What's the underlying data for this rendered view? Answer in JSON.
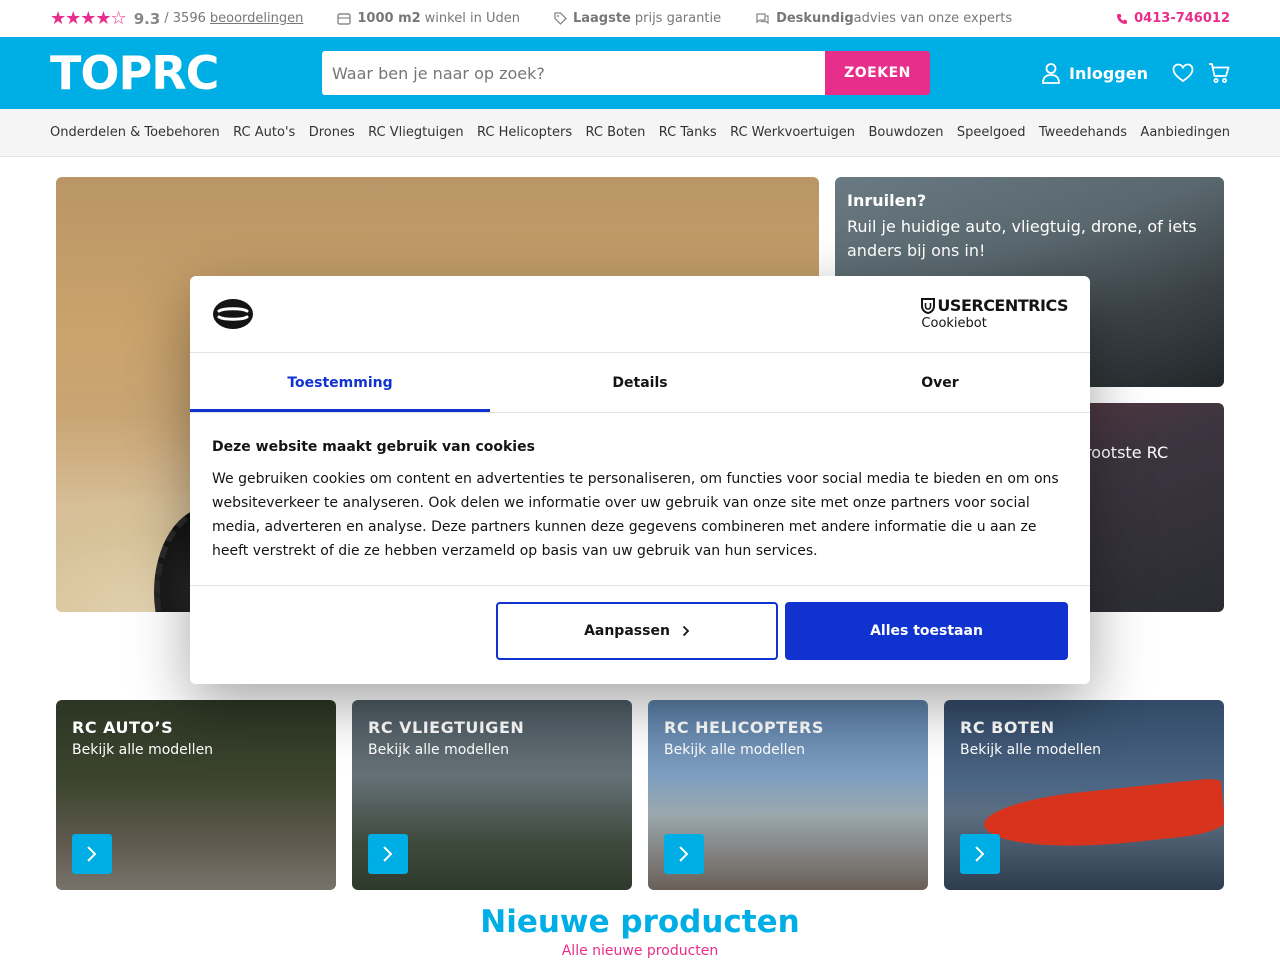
{
  "topbar": {
    "stars": "★★★★☆",
    "score": "9.3",
    "reviews_sep": "/ 3596",
    "reviews_link": "beoordelingen",
    "usp1_bold": "1000 m2",
    "usp1_text": "winkel in Uden",
    "usp2_bold": "Laagste",
    "usp2_text": "prijs garantie",
    "usp3_bold": "Deskundig",
    "usp3_text": "advies van onze experts",
    "phone": "0413-746012"
  },
  "header": {
    "logo": "TOPRC",
    "search_placeholder": "Waar ben je naar op zoek?",
    "search_button": "ZOEKEN",
    "login": "Inloggen"
  },
  "nav": {
    "items": [
      "Onderdelen & Toebehoren",
      "RC Auto's",
      "Drones",
      "RC Vliegtuigen",
      "RC Helicopters",
      "RC Boten",
      "RC Tanks",
      "RC Werkvoertuigen",
      "Bouwdozen",
      "Speelgoed",
      "Tweedehands",
      "Aanbiedingen"
    ]
  },
  "hero": {
    "trade_title": "Inruilen?",
    "trade_desc": "Ruil je huidige auto, vliegtuig, drone, of iets anders bij ons in!",
    "store_desc_partial": "rootste RC"
  },
  "categories": [
    {
      "name": "RC AUTO’S",
      "sub": "Bekijk alle modellen"
    },
    {
      "name": "RC VLIEGTUIGEN",
      "sub": "Bekijk alle modellen"
    },
    {
      "name": "RC HELICOPTERS",
      "sub": "Bekijk alle modellen"
    },
    {
      "name": "RC BOTEN",
      "sub": "Bekijk alle modellen"
    }
  ],
  "new_products": {
    "title": "Nieuwe producten",
    "link": "Alle nieuwe producten"
  },
  "cookie": {
    "brand_top": "USERCENTRICS",
    "brand_bottom": "Cookiebot",
    "tabs": [
      "Toestemming",
      "Details",
      "Over"
    ],
    "heading": "Deze website maakt gebruik van cookies",
    "text": "We gebruiken cookies om content en advertenties te personaliseren, om functies voor social media te bieden en om ons websiteverkeer te analyseren. Ook delen we informatie over uw gebruik van onze site met onze partners voor social media, adverteren en analyse. Deze partners kunnen deze gegevens combineren met andere informatie die u aan ze heeft verstrekt of die ze hebben verzameld op basis van uw gebruik van hun services.",
    "btn_customize": "Aanpassen",
    "btn_allow": "Alles toestaan"
  },
  "colors": {
    "brand_blue": "#00aee6",
    "brand_pink": "#e62e8a",
    "cookie_blue": "#1032cf"
  }
}
